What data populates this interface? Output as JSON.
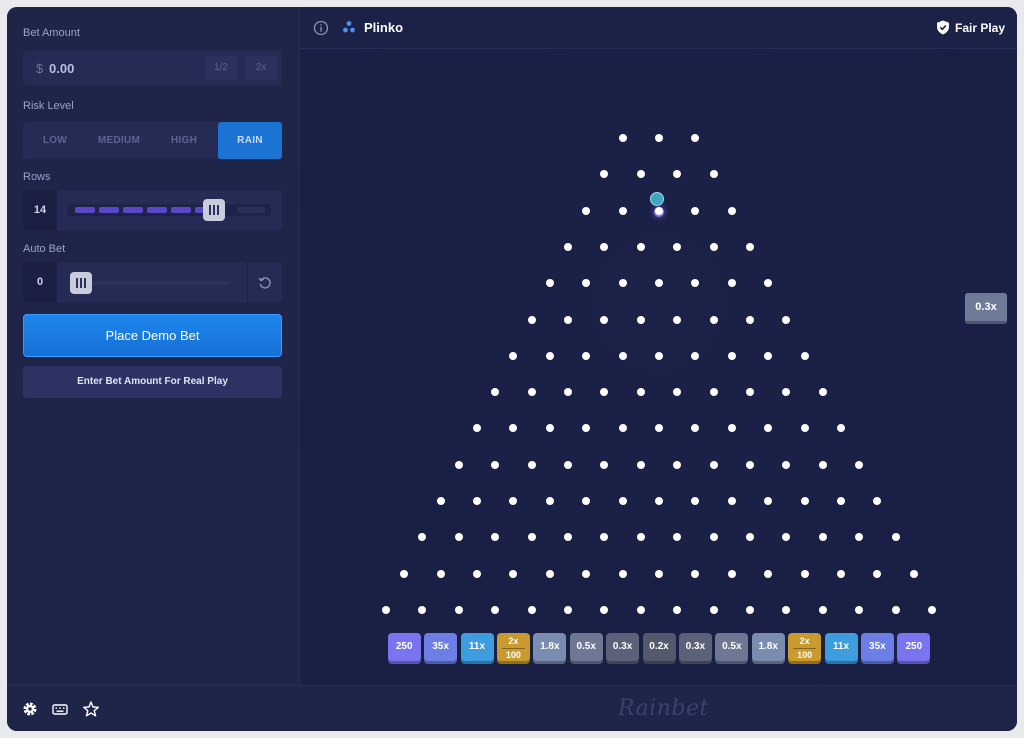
{
  "left_panel": {
    "bet_amount_label": "Bet Amount",
    "bet_currency": "$",
    "bet_value": "0.00",
    "half_label": "1/2",
    "double_label": "2x",
    "risk_label": "Risk Level",
    "risk_options": [
      "LOW",
      "MEDIUM",
      "HIGH",
      "RAIN"
    ],
    "risk_selected": "RAIN",
    "rows_label": "Rows",
    "rows_value": "14",
    "rows_min": 8,
    "rows_max": 16,
    "auto_bet_label": "Auto Bet",
    "auto_bet_value": "0",
    "place_bet_label": "Place Demo Bet",
    "real_play_label": "Enter Bet Amount For Real Play"
  },
  "header": {
    "game_title": "Plinko",
    "fair_play_label": "Fair Play"
  },
  "board": {
    "rows": 14,
    "last_result": "0.3x",
    "multipliers": [
      {
        "label": "250",
        "color": "#7b74f0"
      },
      {
        "label": "35x",
        "color": "#6d7fe6"
      },
      {
        "label": "11x",
        "color": "#3d9ddf"
      },
      {
        "label": "2x",
        "sub": "100",
        "color": "#c99a2e"
      },
      {
        "label": "1.8x",
        "color": "#7a8cb0"
      },
      {
        "label": "0.5x",
        "color": "#6e7895"
      },
      {
        "label": "0.3x",
        "color": "#5b6179"
      },
      {
        "label": "0.2x",
        "color": "#55596c"
      },
      {
        "label": "0.3x",
        "color": "#5b6179"
      },
      {
        "label": "0.5x",
        "color": "#6e7895"
      },
      {
        "label": "1.8x",
        "color": "#7a8cb0"
      },
      {
        "label": "2x",
        "sub": "100",
        "color": "#c99a2e"
      },
      {
        "label": "11x",
        "color": "#3d9ddf"
      },
      {
        "label": "35x",
        "color": "#6d7fe6"
      },
      {
        "label": "250",
        "color": "#7b74f0"
      }
    ]
  },
  "footer": {
    "brand": "Rainbet",
    "icons": [
      "settings-icon",
      "keyboard-icon",
      "star-icon"
    ]
  },
  "colors": {
    "accent_blue": "#1b74d4",
    "background": "#1c2146",
    "peg": "#ffffff"
  }
}
